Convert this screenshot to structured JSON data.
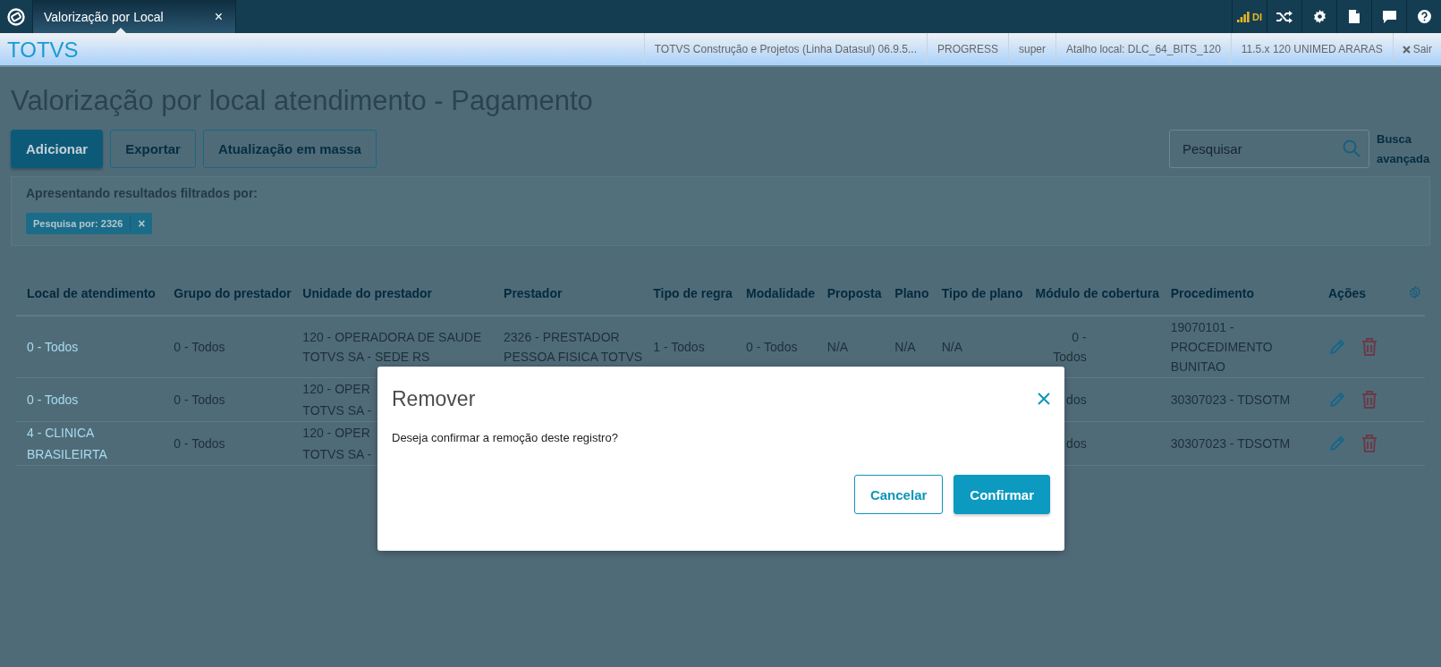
{
  "top_bar": {
    "tabs": [
      {
        "title": "Valorização por Local",
        "close": "×",
        "selected": true
      }
    ],
    "signal_label": "DI"
  },
  "header": {
    "brand": "TOTVS",
    "info": [
      "TOTVS Construção e Projetos (Linha Datasul) 06.9.5...",
      "PROGRESS",
      "super",
      "Atalho local: DLC_64_BITS_120",
      "11.5.x 120 UNIMED ARARAS"
    ],
    "logout": "Sair"
  },
  "page": {
    "title": "Valorização por local atendimento - Pagamento",
    "buttons": [
      {
        "label": "Adicionar",
        "kind": "primary"
      },
      {
        "label": "Exportar",
        "kind": "secondary"
      },
      {
        "label": "Atualização em massa",
        "kind": "secondary"
      }
    ],
    "search": {
      "placeholder": "Pesquisar"
    },
    "advanced_search": "Busca avançada",
    "filter": {
      "caption": "Apresentando resultados filtrados por:",
      "chips": [
        {
          "label": "Pesquisa por: 2326",
          "remove": "×"
        }
      ]
    }
  },
  "table": {
    "columns": [
      "Local de atendimento",
      "Grupo do prestador",
      "Unidade do prestador",
      "Prestador",
      "Tipo de regra",
      "Modalidade",
      "Proposta",
      "Plano",
      "Tipo de plano",
      "Módulo de cobertura",
      "Procedimento",
      "Ações"
    ],
    "rows": [
      {
        "cells": [
          "0 - Todos",
          "0 - Todos",
          "120 - OPERADORA DE SAUDE\nTOTVS SA - SEDE RS",
          "2326 - PRESTADOR\nPESSOA FISICA TOTVS",
          "1 - Todos",
          "0 - Todos",
          "N/A",
          "N/A",
          "N/A",
          "0 - Todos",
          "19070101 -\nPROCEDIMENTO\nBUNITAO"
        ]
      },
      {
        "cells": [
          "0 - Todos",
          "0 - Todos",
          "120 - OPER\nTOTVS SA -",
          null,
          null,
          null,
          null,
          null,
          null,
          "dos",
          "30307023 - TDSOTM"
        ]
      },
      {
        "cells": [
          "4 - CLINICA\nBRASILEIRTA",
          "0 - Todos",
          "120 - OPER\nTOTVS SA -",
          null,
          null,
          null,
          null,
          null,
          null,
          "dos",
          "30307023 - TDSOTM"
        ]
      }
    ]
  },
  "dialog": {
    "title": "Remover",
    "message": "Deseja confirmar a remoção deste registro?",
    "buttons": [
      {
        "label": "Cancelar",
        "kind": "secondary"
      },
      {
        "label": "Confirmar",
        "kind": "primary"
      }
    ]
  }
}
